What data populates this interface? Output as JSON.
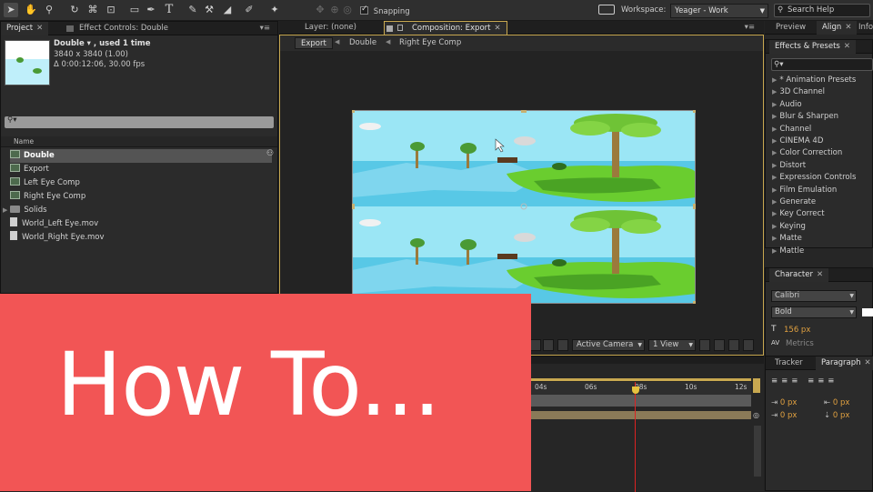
{
  "toolbar": {
    "tools": [
      "selection-tool",
      "hand-tool",
      "zoom-tool",
      "rotate-tool",
      "camera-tool",
      "pan-behind-tool",
      "rectangle-tool",
      "pen-tool",
      "type-tool",
      "brush-tool",
      "clone-stamp-tool",
      "eraser-tool",
      "roto-brush-tool",
      "puppet-tool"
    ],
    "snapping_label": "Snapping",
    "snapping_checked": true,
    "workspace_label": "Workspace:",
    "workspace_value": "Yeager - Work",
    "search_placeholder": "Search Help"
  },
  "project_panel": {
    "tab_project": "Project",
    "tab_effect_controls": "Effect Controls: Double",
    "selected_name": "Double ▾ , used 1 time",
    "dimensions": "3840 x 3840 (1.00)",
    "duration": "Δ 0:00:12:06, 30.00 fps",
    "search_value": "",
    "column_name": "Name",
    "items": [
      {
        "label": "Double",
        "type": "comp",
        "selected": true
      },
      {
        "label": "Export",
        "type": "comp",
        "selected": false
      },
      {
        "label": "Left Eye Comp",
        "type": "comp",
        "selected": false
      },
      {
        "label": "Right Eye Comp",
        "type": "comp",
        "selected": false
      },
      {
        "label": "Solids",
        "type": "folder",
        "selected": false
      },
      {
        "label": "World_Left Eye.mov",
        "type": "file",
        "selected": false
      },
      {
        "label": "World_Right Eye.mov",
        "type": "file",
        "selected": false
      }
    ]
  },
  "viewer": {
    "tab_layer": "Layer: (none)",
    "tab_composition": "Composition: Export",
    "breadcrumbs": [
      "Export",
      "Double",
      "Right Eye Comp"
    ],
    "camera_select": "Active Camera",
    "view_select": "1 View"
  },
  "right_panels": {
    "tab_preview": "Preview",
    "tab_align": "Align",
    "tab_info": "Info",
    "effects_tab": "Effects & Presets",
    "effects_items": [
      "* Animation Presets",
      "3D Channel",
      "Audio",
      "Blur & Sharpen",
      "Channel",
      "CINEMA 4D",
      "Color Correction",
      "Distort",
      "Expression Controls",
      "Film Emulation",
      "Generate",
      "Key Correct",
      "Keying",
      "Matte",
      "Mattle"
    ],
    "character_tab": "Character",
    "font_family": "Calibri",
    "font_style": "Bold",
    "font_size": "156 px",
    "tracking_label": "Metrics",
    "tracker_tab": "Tracker",
    "paragraph_tab": "Paragraph",
    "indent_values": [
      "0 px",
      "0 px",
      "0 px",
      "0 px"
    ]
  },
  "timeline": {
    "ticks": [
      "04s",
      "06s",
      "08s",
      "10s",
      "12s"
    ],
    "playhead_fraction": 0.47
  },
  "overlay": {
    "title": "How To..."
  },
  "colors": {
    "overlay_bg": "#f25555",
    "sky": "#8fe3f4",
    "water": "#53c7e8",
    "grass": "#6ccf2e"
  }
}
